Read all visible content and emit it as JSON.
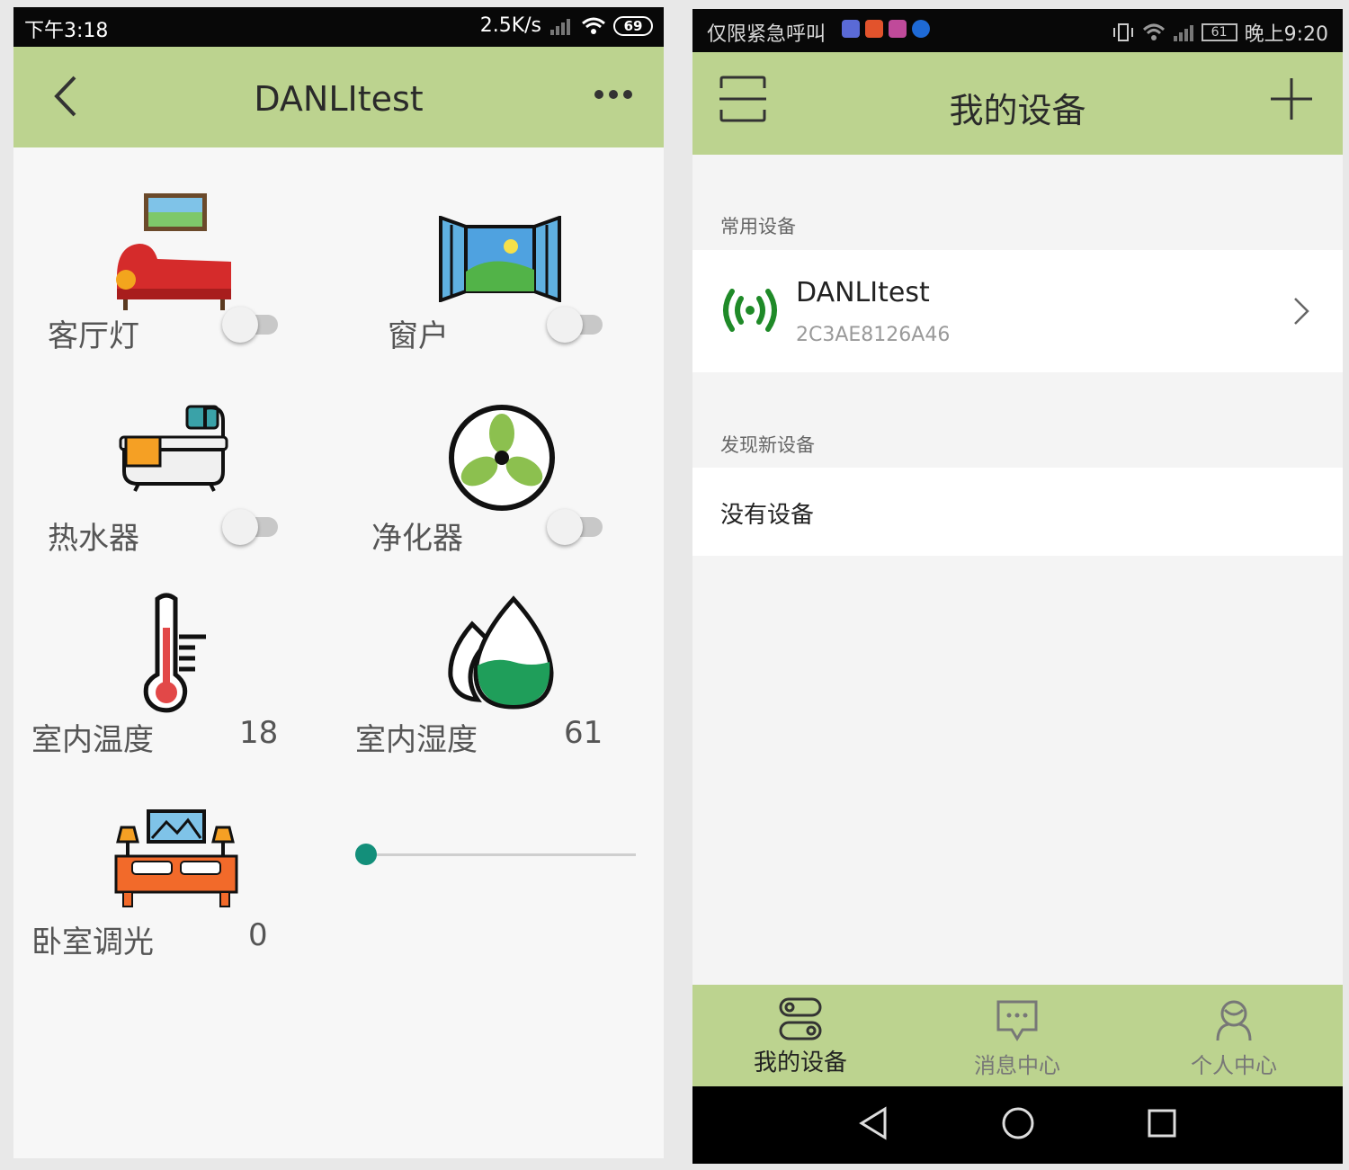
{
  "left_phone": {
    "status_bar": {
      "time": "下午3:18",
      "net_speed": "2.5K/s",
      "battery": "69"
    },
    "header": {
      "title": "DANLItest",
      "back_icon": "chevron-left-icon",
      "more_icon": "more-dots-icon"
    },
    "devices": [
      {
        "label": "客厅灯",
        "icon": "sofa-lamp-icon",
        "control": "toggle",
        "on": false
      },
      {
        "label": "窗户",
        "icon": "window-icon",
        "control": "toggle",
        "on": false
      },
      {
        "label": "热水器",
        "icon": "bathtub-icon",
        "control": "toggle",
        "on": false
      },
      {
        "label": "净化器",
        "icon": "fan-icon",
        "control": "toggle",
        "on": false
      },
      {
        "label": "室内温度",
        "icon": "thermometer-icon",
        "value": "18"
      },
      {
        "label": "室内湿度",
        "icon": "humidity-drops-icon",
        "value": "61"
      },
      {
        "label": "卧室调光",
        "icon": "bedroom-icon",
        "value": "0",
        "slider_level": 0
      }
    ]
  },
  "right_phone": {
    "status_bar": {
      "left_text": "仅限紧急呼叫",
      "battery": "61",
      "time": "晚上9:20"
    },
    "header": {
      "title": "我的设备",
      "scan_icon": "scan-icon",
      "add_icon": "plus-icon"
    },
    "common_section": {
      "title": "常用设备",
      "device": {
        "name": "DANLItest",
        "id": "2C3AE8126A46",
        "icon": "wireless-signal-icon"
      }
    },
    "discover_section": {
      "title": "发现新设备",
      "empty_text": "没有设备"
    },
    "bottom_nav": [
      {
        "label": "我的设备",
        "icon": "devices-icon",
        "active": true
      },
      {
        "label": "消息中心",
        "icon": "message-icon",
        "active": false
      },
      {
        "label": "个人中心",
        "icon": "user-icon",
        "active": false
      }
    ],
    "colors": {
      "accent": "#bcd38f",
      "signal_green": "#1f8a28"
    }
  }
}
